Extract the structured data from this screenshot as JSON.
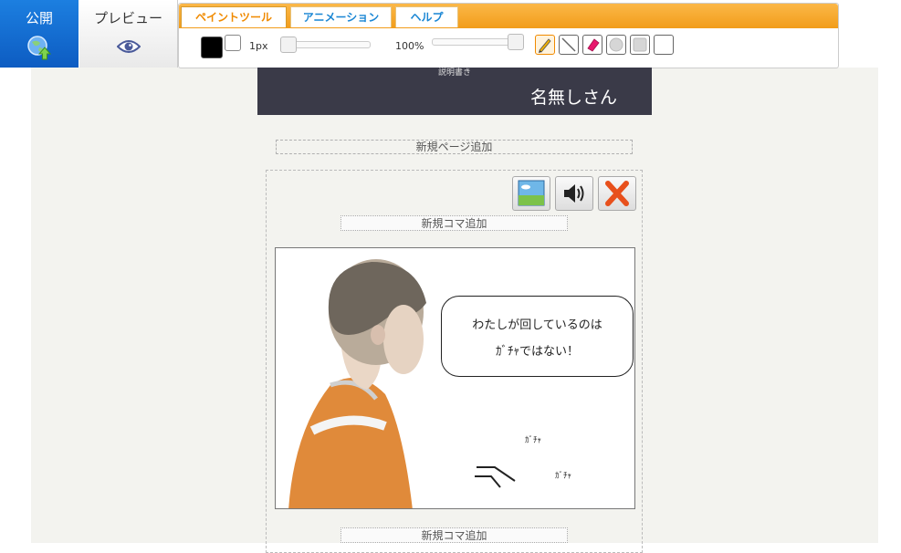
{
  "toolbar": {
    "publish_label": "公開",
    "preview_label": "プレビュー",
    "tabs": [
      {
        "label": "ペイントツール",
        "active": true
      },
      {
        "label": "アニメーション",
        "active": false
      },
      {
        "label": "ヘルプ",
        "active": false
      }
    ],
    "brush_size": "1px",
    "opacity": "100%",
    "primary_color": "#000000",
    "secondary_color": "#ffffff",
    "tools": [
      "pencil-icon",
      "line-icon",
      "eraser-icon",
      "circle-icon",
      "square-icon",
      "blank-icon"
    ]
  },
  "header": {
    "description": "説明書き",
    "author": "名無しさん"
  },
  "editor": {
    "add_page_label": "新規ページ追加",
    "add_frame_label_top": "新規コマ追加",
    "add_frame_label_bottom": "新規コマ追加",
    "action_buttons": [
      "image-icon",
      "sound-icon",
      "delete-icon"
    ]
  },
  "panel": {
    "bubble_line1": "わたしが回しているのは",
    "bubble_line2": "ｶﾞﾁｬではない！",
    "sfx1": "ｶﾞﾁｬ",
    "sfx2": "ｶﾞﾁｬ"
  }
}
